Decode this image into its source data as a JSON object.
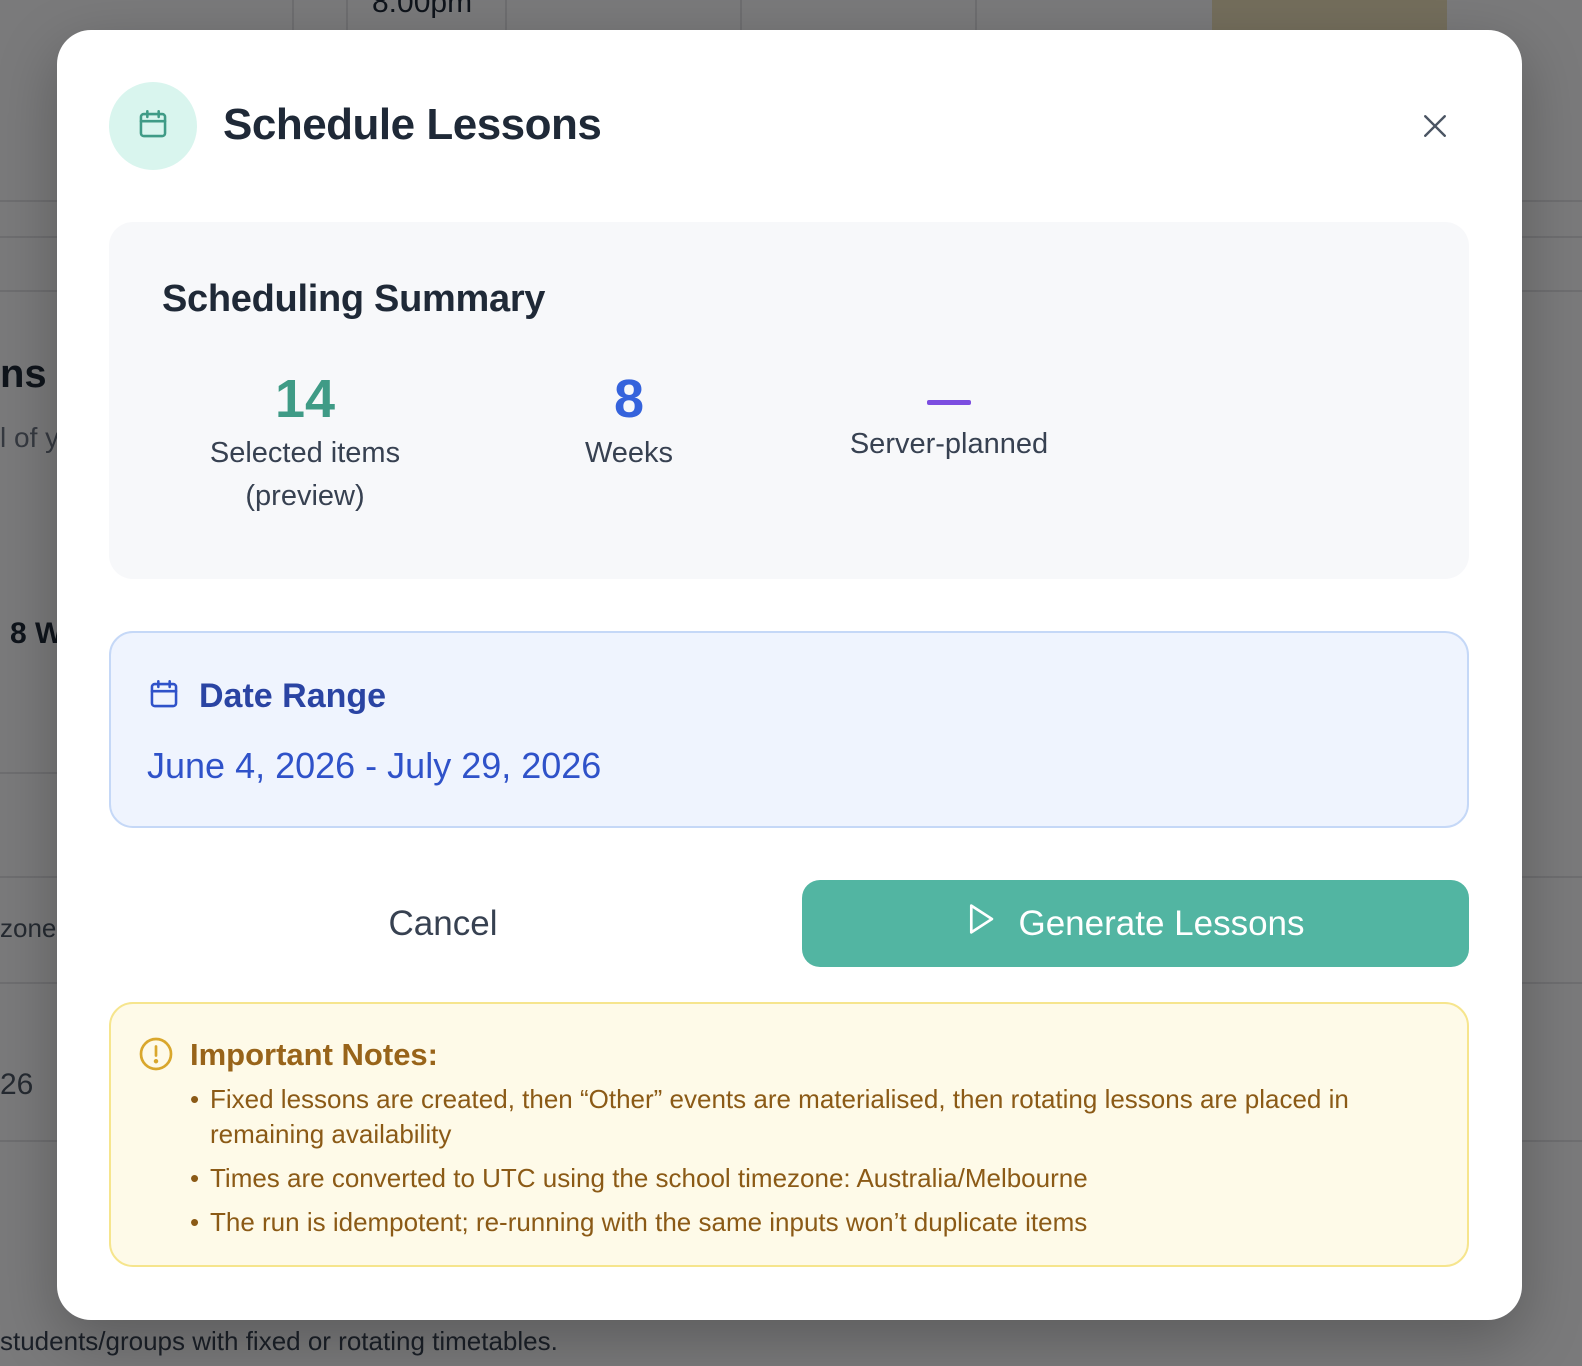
{
  "background": {
    "time_label": "8:00pm",
    "heading_fragment": "ns",
    "subtext_fragment": "l of y",
    "weeks_fragment": "8 W",
    "zone_fragment": "zone",
    "date_fragment": "26",
    "footer_text": "students/groups with fixed or rotating timetables."
  },
  "modal": {
    "icon": "calendar-icon",
    "title": "Schedule Lessons",
    "close_icon": "close-icon"
  },
  "summary": {
    "title": "Scheduling Summary",
    "stats": [
      {
        "value": "14",
        "label_line1": "Selected items",
        "label_line2": "(preview)",
        "color": "#3f9b86"
      },
      {
        "value": "8",
        "label_line1": "Weeks",
        "color": "#3563dc"
      },
      {
        "value": "",
        "label_line1": "Server-planned",
        "color": "#7c4ee0"
      }
    ]
  },
  "date_range": {
    "icon": "calendar-icon",
    "title": "Date Range",
    "value": "June 4, 2026 - July 29, 2026"
  },
  "actions": {
    "cancel_label": "Cancel",
    "generate_label": "Generate Lessons",
    "generate_icon": "play-icon",
    "generate_color": "#52b5a2"
  },
  "notes": {
    "icon": "alert-circle-icon",
    "title": "Important Notes:",
    "items": [
      "Fixed lessons are created, then “Other” events are materialised, then rotating lessons are placed in remaining availability",
      "Times are converted to UTC using the school timezone: Australia/Melbourne",
      "The run is idempotent; re-running with the same inputs won’t duplicate items"
    ]
  }
}
